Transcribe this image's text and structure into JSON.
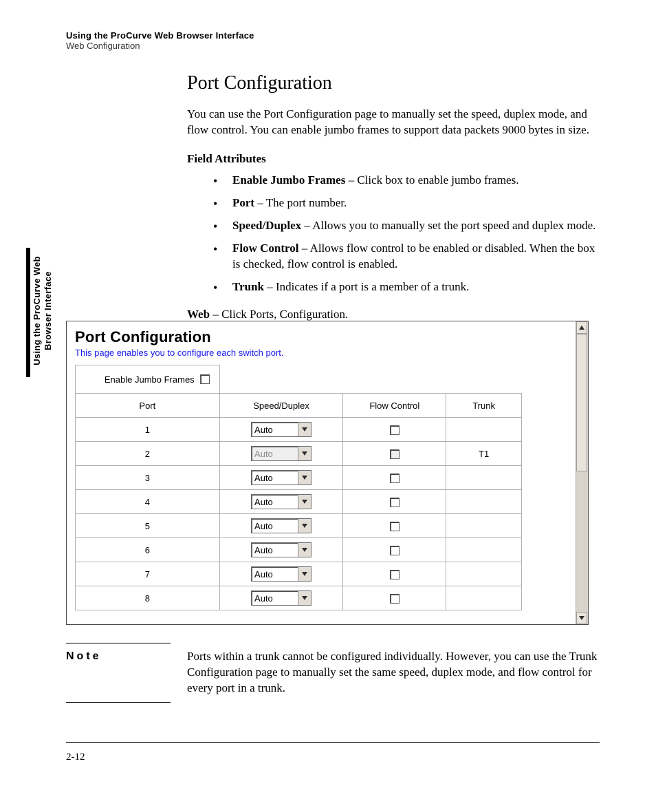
{
  "header": {
    "line1": "Using the ProCurve Web Browser Interface",
    "line2": "Web Configuration"
  },
  "sideTab": {
    "line1": "Using the ProCurve Web",
    "line2": "Browser Interface"
  },
  "section": {
    "title": "Port Configuration",
    "lead": "You can use the Port Configuration page to manually set the speed, duplex mode, and flow control. You can enable jumbo frames to support data packets 9000 bytes in size.",
    "attrsHead": "Field Attributes",
    "attrs": [
      {
        "term": "Enable Jumbo Frames",
        "desc": " – Click box to enable jumbo frames."
      },
      {
        "term": "Port",
        "desc": " – The port number."
      },
      {
        "term": "Speed/Duplex",
        "desc": " – Allows you to manually set the port speed and duplex mode."
      },
      {
        "term": "Flow Control",
        "desc": " – Allows flow control to be enabled or disabled. When the box is checked, flow control is enabled."
      },
      {
        "term": "Trunk",
        "desc": " – Indicates if a port is a member of a trunk."
      }
    ],
    "webLabel": "Web",
    "webPath": " – Click Ports, Configuration."
  },
  "screenshot": {
    "title": "Port Configuration",
    "desc": "This page enables you to configure each switch port.",
    "jumboLabel": "Enable Jumbo Frames",
    "headers": {
      "port": "Port",
      "speed": "Speed/Duplex",
      "flow": "Flow Control",
      "trunk": "Trunk"
    },
    "rows": [
      {
        "port": "1",
        "speed": "Auto",
        "disabled": false,
        "flowDisabled": false,
        "trunk": ""
      },
      {
        "port": "2",
        "speed": "Auto",
        "disabled": true,
        "flowDisabled": true,
        "trunk": "T1"
      },
      {
        "port": "3",
        "speed": "Auto",
        "disabled": false,
        "flowDisabled": false,
        "trunk": ""
      },
      {
        "port": "4",
        "speed": "Auto",
        "disabled": false,
        "flowDisabled": false,
        "trunk": ""
      },
      {
        "port": "5",
        "speed": "Auto",
        "disabled": false,
        "flowDisabled": false,
        "trunk": ""
      },
      {
        "port": "6",
        "speed": "Auto",
        "disabled": false,
        "flowDisabled": false,
        "trunk": ""
      },
      {
        "port": "7",
        "speed": "Auto",
        "disabled": false,
        "flowDisabled": false,
        "trunk": ""
      },
      {
        "port": "8",
        "speed": "Auto",
        "disabled": false,
        "flowDisabled": false,
        "trunk": ""
      }
    ]
  },
  "note": {
    "label": "Note",
    "text": "Ports within a trunk cannot be configured individually. However, you can use the Trunk Configuration page to manually set the same speed, duplex mode, and flow control for every port in a trunk."
  },
  "pageNum": "2-12"
}
